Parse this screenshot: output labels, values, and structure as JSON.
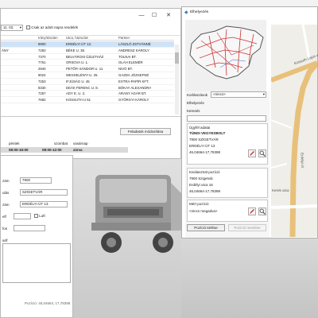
{
  "main": {
    "date_value": "11. 03.",
    "checkbox_label": "Csak az adott napra rendelék",
    "columns": [
      "Irányítószám",
      "Utca, házszám",
      "Partner"
    ],
    "rows": [
      {
        "lead": "",
        "zip": "8900",
        "street": "ERDÉLYI ÚT 13.",
        "partner": "LÁSZLÓ ZSTVÁNNÉ",
        "selected": true
      },
      {
        "lead": "ÁNY",
        "zip": "7283",
        "street": "BÉKE U. 38.",
        "partner": "ANDRESZ KÁROLY",
        "selected": false
      },
      {
        "lead": "",
        "zip": "7370",
        "street": "BELVÁROSI ÜZLETHÁZ",
        "partner": "TOLNAI BT.",
        "selected": false
      },
      {
        "lead": "",
        "zip": "7761",
        "street": "ORSOVA U. 1.",
        "partner": "OLÁH ELEMÉR",
        "selected": false
      },
      {
        "lead": "",
        "zip": "2940",
        "street": "PETŐFI SÁNDOR U. 11.",
        "partner": "NIVÓ BT.",
        "selected": false
      },
      {
        "lead": "",
        "zip": "9024",
        "street": "WESSELÉNYI U. 25.",
        "partner": "GAZDA JÓZSEFNÉ",
        "selected": false
      },
      {
        "lead": "",
        "zip": "7253",
        "street": "IFJÚSÁG U. 45",
        "partner": "EXTRA-PAPÍR KFT.",
        "selected": false
      },
      {
        "lead": "",
        "zip": "8330",
        "street": "DEÁK FERENC U. 8.",
        "partner": "BÓKAY ALEXANDRA",
        "selected": false
      },
      {
        "lead": "",
        "zip": "7257",
        "street": "ADY E. U. 2.",
        "partner": "ARANY AGÁR BT.",
        "selected": false
      },
      {
        "lead": "",
        "zip": "7682",
        "street": "KOSSUTH U 51",
        "partner": "GYÖRGYI KÁROLY",
        "selected": false
      }
    ],
    "tasks_button": "Feladatok módosítása",
    "days": [
      "péntek",
      "szombat",
      "vasárnap"
    ],
    "times": [
      "08:00-16:00",
      "08:00-12:00",
      "zárva"
    ]
  },
  "detail": {
    "labels": [
      "zám",
      "ulás",
      "zám",
      "elf",
      "fon",
      "artf"
    ],
    "zip_value": "7900",
    "city_value": "SZIGETVÁR",
    "street_value": "ERDÉLYI ÚT 13.",
    "checkbox_label": "Luft",
    "position_text": "Pozíció: 46,04664, 17,78398"
  },
  "map": {
    "window_title": "Elhelyezés",
    "county_label": "Korlátozások",
    "county_value": "<nincs>",
    "panel_title": "Elhelyezés",
    "search_label": "Keresés",
    "customer_heading": "Ügyfél adatai",
    "customer_name": "TÜNDI VEGYESBOLT",
    "customer_city": "7900 SZIGETVÁR",
    "customer_street": "ERDÉLYI ÚT 13",
    "customer_coords": "46,04664-17,78398",
    "selected_heading": "Kiválasztott pozíció",
    "selected_city": "7900 Szigetvár",
    "selected_street": "Erdélyi utca 16",
    "selected_coords": "46,04664-17,78398",
    "saved_heading": "Mért pozíció",
    "saved_value": "<nincs megadva>",
    "save_button": "Pozíció törlése",
    "save_button2": "Pozíció mentése",
    "street_labels": [
      "Kossuth Lajos utca",
      "Erdélyi út",
      "Kerek utca"
    ]
  }
}
